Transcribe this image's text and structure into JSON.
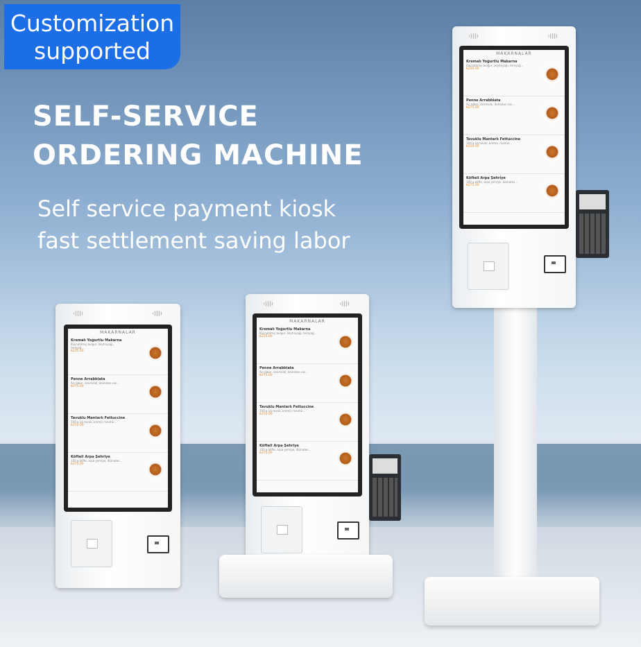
{
  "badge": {
    "line1": "Customization",
    "line2": "supported"
  },
  "headline": {
    "line1": "SELF-SERVICE",
    "line2": "ORDERING MACHINE"
  },
  "subheadline": {
    "line1": "Self service payment kiosk",
    "line2": "fast settlement saving labor"
  },
  "kiosk_menu": {
    "header": "MAKARNALAR",
    "items": [
      {
        "name": "Kremalı Yoğurtlu Makarna",
        "desc": "Kaynatılmış bulgur, zeytinyağı, tereyağ...",
        "price": "₺235.00"
      },
      {
        "name": "Penne Arrabbiata",
        "desc": "Acı biber, sarımsak, domates sos...",
        "price": "₺275.00"
      },
      {
        "name": "Tavuklu Mantarlı Fettuccine",
        "desc": "100 g şiş tavuk, krema, mantar...",
        "price": "₺350.00"
      },
      {
        "name": "Köfteli Arpa Şehriye",
        "desc": "100 g köfte, arpa şehriye, domates...",
        "price": "₺275.00"
      }
    ]
  },
  "colors": {
    "badge_bg": "#1b6ee6",
    "headline_text": "#ffffff",
    "price_text": "#e08a2a"
  }
}
